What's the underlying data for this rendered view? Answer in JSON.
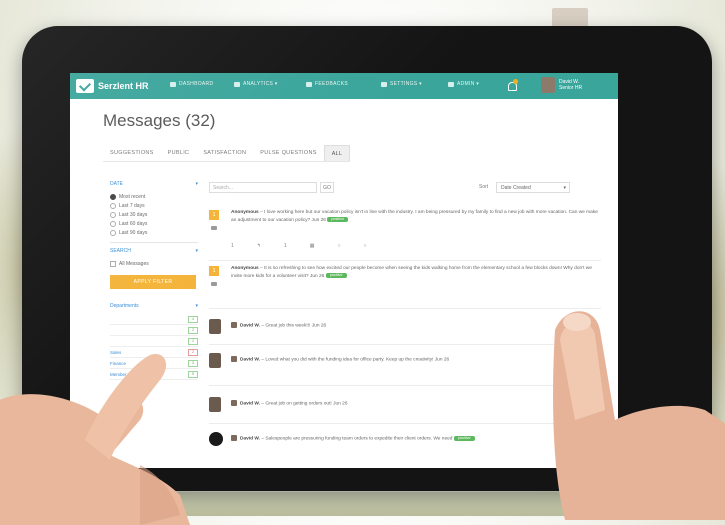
{
  "app": {
    "brand": "Serzlent HR",
    "nav": [
      "DASHBOARD",
      "ANALYTICS ▾",
      "FEEDBACKS",
      "SETTINGS ▾",
      "ADMIN ▾"
    ],
    "user_name": "David W.\nSenior HR"
  },
  "page": {
    "title": "Messages (32)",
    "tabs": [
      "SUGGESTIONS",
      "PUBLIC",
      "SATISFACTION",
      "PULSE QUESTIONS",
      "ALL"
    ],
    "active_tab": "ALL"
  },
  "sidebar": {
    "date_header": "DATE",
    "date_options": [
      "Most recent",
      "Last 7 days",
      "Last 30 days",
      "Last 60 days",
      "Last 90 days"
    ],
    "selected_date": "Most recent",
    "filter_header": "SEARCH",
    "all_messages": "All Messages",
    "apply_button": "APPLY FILTER",
    "departments_header": "Departments",
    "dept_rows": [
      {
        "label": "",
        "badge": "4",
        "color": "green"
      },
      {
        "label": "",
        "badge": "2",
        "color": "green"
      },
      {
        "label": "",
        "badge": "1",
        "color": "green"
      },
      {
        "label": "Sales",
        "badge": "2",
        "color": "red"
      },
      {
        "label": "Finance",
        "badge": "3",
        "color": "green"
      },
      {
        "label": "Member",
        "badge": "5",
        "color": "green"
      }
    ]
  },
  "toolbar": {
    "search_placeholder": "Search...",
    "go_label": "GO",
    "sort_label": "Sort",
    "sort_value": "Date Created"
  },
  "messages": [
    {
      "author": "Anonymous",
      "text": "I love working here but our vacation policy isn't in line with the industry. I am being pressured by my family to find a new job with more vacation. Can we make an adjustment to our vacation policy?",
      "date": "Jun 26",
      "tag": "positive",
      "vote": "1",
      "actions": [
        "1",
        "↰",
        "1",
        "▦",
        "○",
        "○"
      ]
    },
    {
      "author": "Anonymous",
      "text": "It is so refreshing to see how excited our people become when seeing the kids walking home from the elementary school a few blocks down! Why don't we invite more kids for a volunteer visit?",
      "date": "Jun 26",
      "tag": "positive",
      "vote": "1"
    },
    {
      "author": "David W.",
      "text": "Great job this week!!!",
      "date": "Jun 26"
    },
    {
      "author": "David W.",
      "text": "Loved what you did with the funding idea for office party. Keep up the creativity!",
      "date": "Jun 26"
    },
    {
      "author": "David W.",
      "text": "Great job on getting orders out!",
      "date": "Jun 26"
    },
    {
      "author": "David W.",
      "text": "Salespeople are pressuring funding team orders to expedite their client orders. We need",
      "date": "",
      "tag": "positive"
    }
  ]
}
